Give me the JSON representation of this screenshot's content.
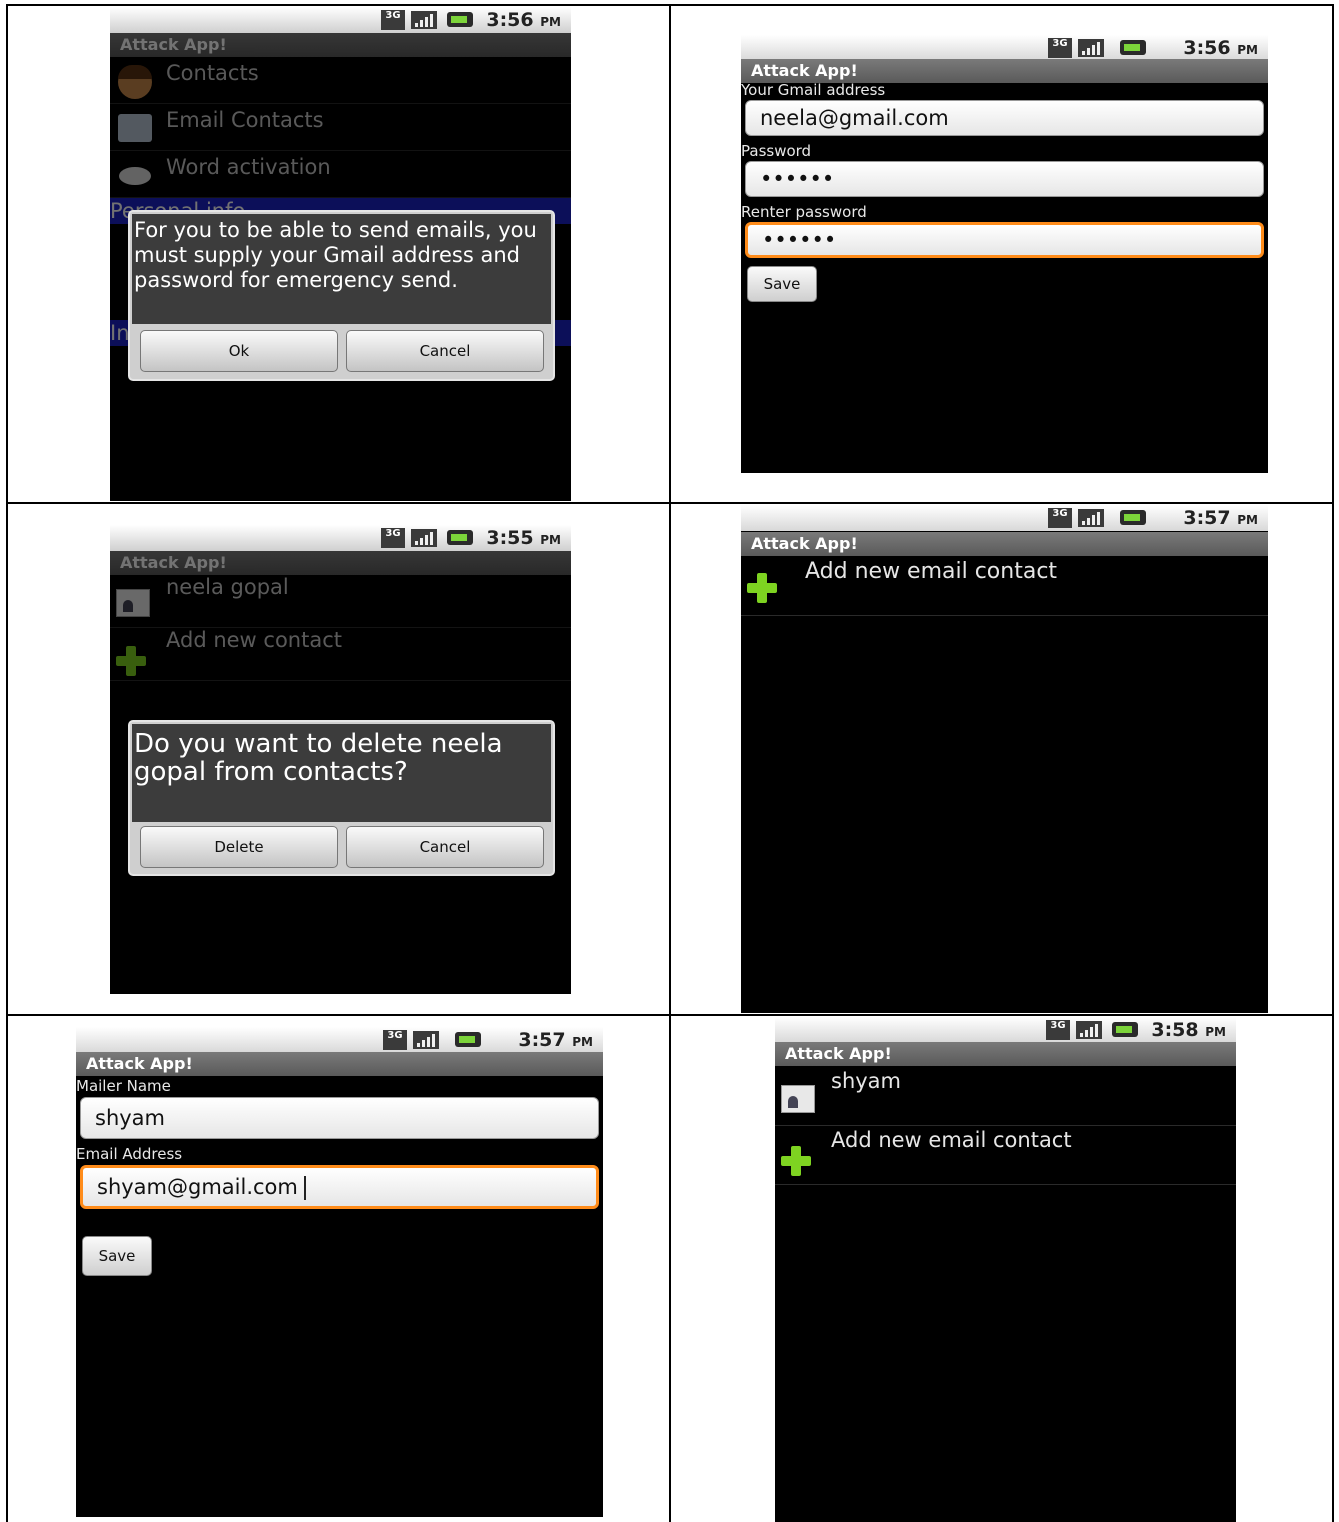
{
  "app_title": "Attack App!",
  "s1": {
    "time": "3:56",
    "pm": "PM",
    "items": [
      "Contacts",
      "Email Contacts",
      "Word activation"
    ],
    "hidden_header_1": "Personal info",
    "hidden_header_2": "In",
    "dialog_message": "For you to be able to send emails, you must supply your Gmail address and password for emergency send.",
    "ok_label": "Ok",
    "cancel_label": "Cancel"
  },
  "s2": {
    "time": "3:56",
    "pm": "PM",
    "email_label": "Your Gmail address",
    "email_value": "neela@gmail.com",
    "password_label": "Password",
    "password_value": "••••••",
    "renter_label": "Renter password",
    "renter_value": "••••••",
    "save_label": "Save"
  },
  "s3": {
    "time": "3:55",
    "pm": "PM",
    "contact_name": "neela gopal",
    "add_label": "Add new contact",
    "dialog_message": "Do you want to delete neela gopal  from contacts?",
    "delete_label": "Delete",
    "cancel_label": "Cancel"
  },
  "s4": {
    "time": "3:57",
    "pm": "PM",
    "add_label": "Add new email contact"
  },
  "s5": {
    "time": "3:57",
    "pm": "PM",
    "name_label": "Mailer Name",
    "name_value": "shyam",
    "email_label": "Email Address",
    "email_value": "shyam@gmail.com",
    "save_label": "Save"
  },
  "s6": {
    "time": "3:58",
    "pm": "PM",
    "contact_name": "shyam",
    "add_label": "Add new email contact"
  },
  "status_icons": [
    "3g-icon",
    "signal-icon",
    "battery-icon"
  ]
}
